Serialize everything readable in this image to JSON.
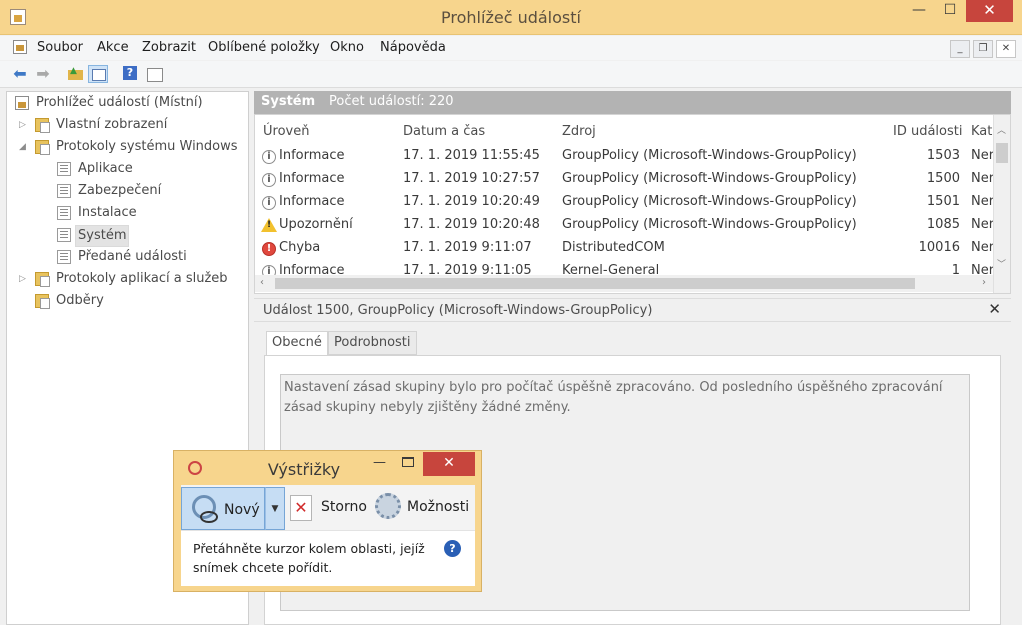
{
  "window": {
    "title": "Prohlížeč událostí",
    "min_glyph": "—",
    "max_glyph": "☐",
    "close_glyph": "✕"
  },
  "menu": {
    "items": [
      "Soubor",
      "Akce",
      "Zobrazit",
      "Oblíbené položky",
      "Okno",
      "Nápověda"
    ],
    "mdi_min": "_",
    "mdi_restore": "❐",
    "mdi_close": "✕"
  },
  "toolbar": {
    "icons": [
      "back-arrow-icon",
      "forward-arrow-icon",
      "up-folder-icon",
      "show-pane-icon",
      "help-icon",
      "properties-icon"
    ]
  },
  "tree": {
    "root": "Prohlížeč událostí (Místní)",
    "nodes": [
      {
        "label": "Vlastní zobrazení",
        "expander": "▷"
      },
      {
        "label": "Protokoly systému Windows",
        "expander": "◢"
      },
      {
        "label": "Aplikace"
      },
      {
        "label": "Zabezpečení"
      },
      {
        "label": "Instalace"
      },
      {
        "label": "Systém",
        "selected": true
      },
      {
        "label": "Předané události"
      },
      {
        "label": "Protokoly aplikací a služeb",
        "expander": "▷"
      },
      {
        "label": "Odběry"
      }
    ]
  },
  "events": {
    "log_name": "Systém",
    "count_text": "Počet událostí: 220",
    "columns": [
      "Úroveň",
      "Datum a čas",
      "Zdroj",
      "ID události",
      "Kat"
    ],
    "rows": [
      {
        "level": "Informace",
        "level_icon": "info-icon",
        "datetime": "17. 1. 2019 11:55:45",
        "source": "GroupPolicy (Microsoft-Windows-GroupPolicy)",
        "id": "1503",
        "cat": "Ner"
      },
      {
        "level": "Informace",
        "level_icon": "info-icon",
        "datetime": "17. 1. 2019 10:27:57",
        "source": "GroupPolicy (Microsoft-Windows-GroupPolicy)",
        "id": "1500",
        "cat": "Ner"
      },
      {
        "level": "Informace",
        "level_icon": "info-icon",
        "datetime": "17. 1. 2019 10:20:49",
        "source": "GroupPolicy (Microsoft-Windows-GroupPolicy)",
        "id": "1501",
        "cat": "Ner"
      },
      {
        "level": "Upozornění",
        "level_icon": "warning-icon",
        "datetime": "17. 1. 2019 10:20:48",
        "source": "GroupPolicy (Microsoft-Windows-GroupPolicy)",
        "id": "1085",
        "cat": "Ner"
      },
      {
        "level": "Chyba",
        "level_icon": "error-icon",
        "datetime": "17. 1. 2019 9:11:07",
        "source": "DistributedCOM",
        "id": "10016",
        "cat": "Ner"
      },
      {
        "level": "Informace",
        "level_icon": "info-icon",
        "datetime": "17. 1. 2019 9:11:05",
        "source": "Kernel-General",
        "id": "1",
        "cat": "Ner"
      }
    ]
  },
  "detail": {
    "title": "Událost 1500, GroupPolicy (Microsoft-Windows-GroupPolicy)",
    "close_glyph": "✕",
    "tabs": [
      "Obecné",
      "Podrobnosti"
    ],
    "active_tab": "Obecné",
    "description": "Nastavení zásad skupiny bylo pro počítač úspěšně zpracováno. Od posledního úspěšného zpracování zásad skupiny nebyly zjištěny žádné změny."
  },
  "snip": {
    "title": "Výstřižky",
    "min_glyph": "—",
    "close_glyph": "✕",
    "new_label": "Nový",
    "dropdown_glyph": "▼",
    "cancel_label": "Storno",
    "options_label": "Možnosti",
    "message": "Přetáhněte kurzor kolem oblasti, jejíž snímek chcete pořídit.",
    "help_glyph": "?"
  },
  "colors": {
    "titlebar": "#f7d58d",
    "close_button": "#c7453d",
    "header_band": "#b3b3b3",
    "selection": "#c6ddf4"
  }
}
